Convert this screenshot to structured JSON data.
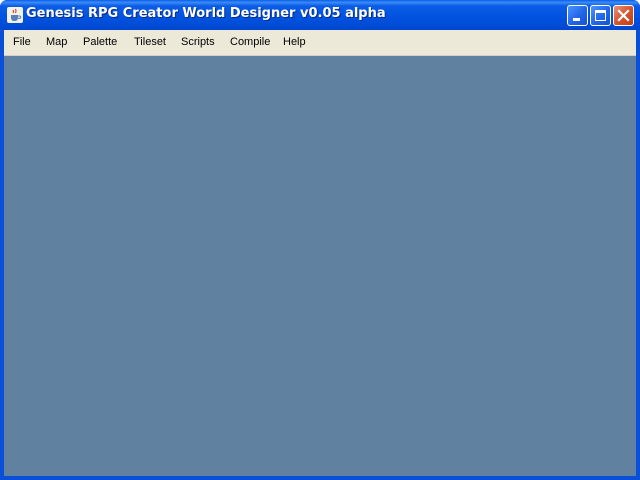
{
  "window": {
    "title": "Genesis RPG Creator World Designer v0.05 alpha",
    "icon": "java-cup-icon",
    "controls": [
      "minimize-icon",
      "maximize-icon",
      "close-icon"
    ]
  },
  "menubar": {
    "items": [
      {
        "label": "File"
      },
      {
        "label": "Map"
      },
      {
        "label": "Palette"
      },
      {
        "label": "Tileset"
      },
      {
        "label": "Scripts"
      },
      {
        "label": "Compile"
      },
      {
        "label": "Help"
      }
    ]
  },
  "colors": {
    "titlebar": "#0052df",
    "menubar": "#ece9d8",
    "client_area": "#6082a0",
    "close_button": "#d6552f"
  }
}
